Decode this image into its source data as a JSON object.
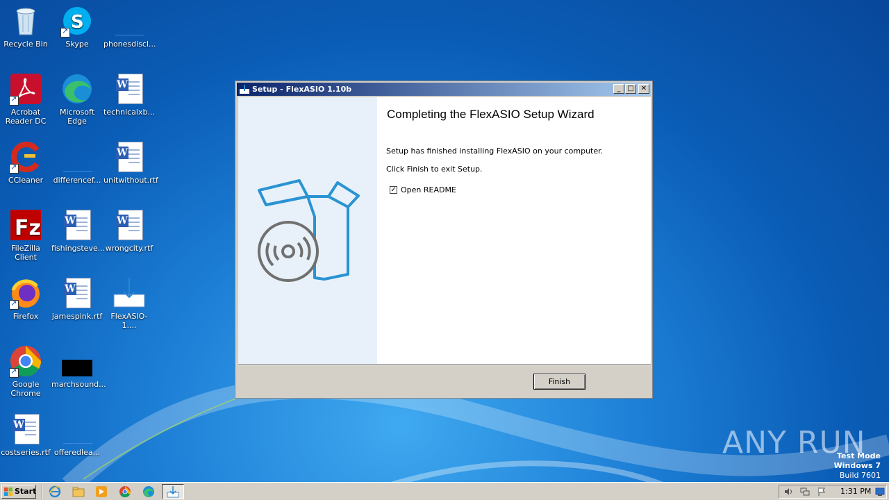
{
  "desktop": {
    "icons": [
      {
        "label": "Recycle Bin"
      },
      {
        "label": "Skype"
      },
      {
        "label": "phonesdiscl..."
      },
      {
        "label": "Acrobat Reader DC"
      },
      {
        "label": "Microsoft Edge"
      },
      {
        "label": "technicalxb..."
      },
      {
        "label": "CCleaner"
      },
      {
        "label": "differencef..."
      },
      {
        "label": "unitwithout.rtf"
      },
      {
        "label": "FileZilla Client"
      },
      {
        "label": "fishingsteve..."
      },
      {
        "label": "wrongcity.rtf"
      },
      {
        "label": "Firefox"
      },
      {
        "label": "jamespink.rtf"
      },
      {
        "label": "FlexASIO-1...."
      },
      {
        "label": "Google Chrome"
      },
      {
        "label": "marchsound..."
      },
      {
        "label": "costseries.rtf"
      },
      {
        "label": "offeredlea..."
      }
    ]
  },
  "window": {
    "title": "Setup - FlexASIO 1.10b",
    "heading": "Completing the FlexASIO Setup Wizard",
    "text1": "Setup has finished installing FlexASIO on your computer.",
    "text2": "Click Finish to exit Setup.",
    "checkbox_label": "Open README",
    "checkbox_checked": true,
    "finish_label": "Finish"
  },
  "taskbar": {
    "start_label": "Start",
    "clock": "1:31 PM"
  },
  "watermark": {
    "brand": "ANY RUN",
    "mode": "Test Mode",
    "os": "Windows 7",
    "build": "Build 7601"
  }
}
